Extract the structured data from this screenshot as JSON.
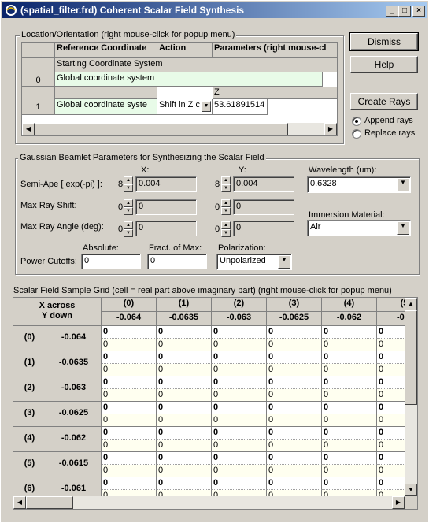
{
  "window": {
    "title": "(spatial_filter.frd) Coherent Scalar Field Synthesis",
    "minimize": "_",
    "maximize": "□",
    "close": "×"
  },
  "buttons": {
    "dismiss": "Dismiss",
    "help": "Help",
    "create_rays": "Create Rays"
  },
  "ray_mode": {
    "append": "Append rays",
    "replace": "Replace rays",
    "selected": "append"
  },
  "location": {
    "label": "Location/Orientation (right mouse-click for popup menu)",
    "headers": [
      "Reference Coordinate",
      "Action",
      "Parameters (right mouse-cl"
    ],
    "row0": {
      "num": "0",
      "section": "Starting Coordinate System",
      "value": "Global coordinate system"
    },
    "row1": {
      "num": "1",
      "z_label": "Z",
      "ref": "Global coordinate syste",
      "action": "Shift in Z c",
      "param": "53.61891514"
    }
  },
  "gaussian": {
    "label": "Gaussian Beamlet Parameters for Synthesizing the Scalar Field",
    "x_label": "X:",
    "y_label": "Y:",
    "rows": [
      {
        "label": "Semi-Ape [ exp(-pi) ]:",
        "xspin": "8",
        "x": "0.004",
        "yspin": "8",
        "y": "0.004"
      },
      {
        "label": "Max Ray Shift:",
        "xspin": "0",
        "x": "0",
        "yspin": "0",
        "y": "0"
      },
      {
        "label": "Max Ray Angle (deg):",
        "xspin": "0",
        "x": "0",
        "yspin": "0",
        "y": "0"
      }
    ],
    "wavelength_label": "Wavelength (um):",
    "wavelength": "0.6328",
    "immersion_label": "Immersion Material:",
    "immersion": "Air",
    "absolute_label": "Absolute:",
    "fract_label": "Fract. of Max:",
    "polarization_label": "Polarization:",
    "power_cutoffs_label": "Power Cutoffs:",
    "absolute": "0",
    "fract": "0",
    "polarization": "Unpolarized"
  },
  "grid": {
    "label": "Scalar Field Sample Grid  (cell = real part above imaginary part)  (right mouse-click for popup menu)",
    "corner1": "X across",
    "corner2": "Y down",
    "cols": [
      {
        "idx": "(0)",
        "val": "-0.064"
      },
      {
        "idx": "(1)",
        "val": "-0.0635"
      },
      {
        "idx": "(2)",
        "val": "-0.063"
      },
      {
        "idx": "(3)",
        "val": "-0.0625"
      },
      {
        "idx": "(4)",
        "val": "-0.062"
      },
      {
        "idx": "(5",
        "val": "-0.0"
      }
    ],
    "rows": [
      {
        "idx": "(0)",
        "val": "-0.064"
      },
      {
        "idx": "(1)",
        "val": "-0.0635"
      },
      {
        "idx": "(2)",
        "val": "-0.063"
      },
      {
        "idx": "(3)",
        "val": "-0.0625"
      },
      {
        "idx": "(4)",
        "val": "-0.062"
      },
      {
        "idx": "(5)",
        "val": "-0.0615"
      },
      {
        "idx": "(6)",
        "val": "-0.061"
      }
    ],
    "cell_value": "0"
  }
}
